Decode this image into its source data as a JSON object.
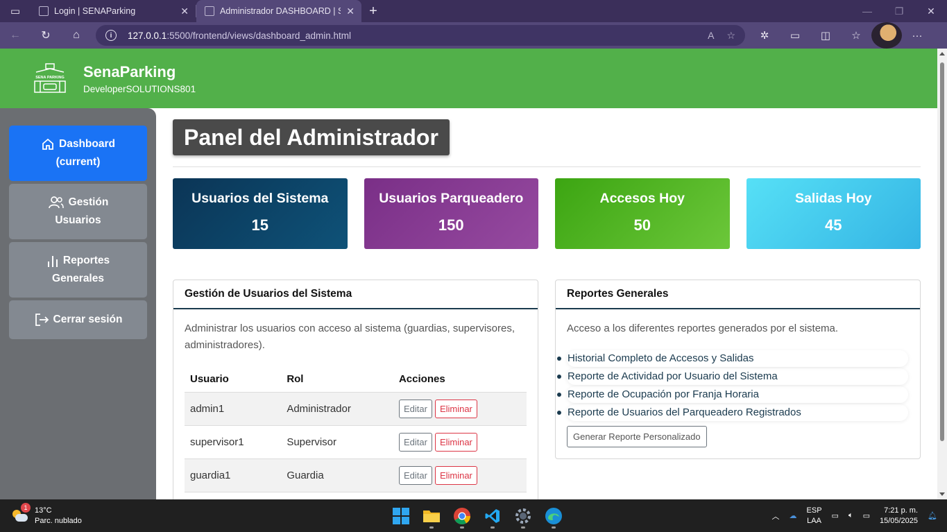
{
  "browser": {
    "tabs": [
      {
        "title": "Login | SENAParking",
        "active": false
      },
      {
        "title": "Administrador DASHBOARD | SEN",
        "active": true
      }
    ],
    "url_host": "127.0.0.1",
    "url_path": ":5500/frontend/views/dashboard_admin.html"
  },
  "header": {
    "brand": "SenaParking",
    "subtitle": "DeveloperSOLUTIONS801",
    "logo_text": "SENA PARKING"
  },
  "sidebar": {
    "items": [
      {
        "label_line1": "Dashboard",
        "label_line2": "(current)",
        "active": true
      },
      {
        "label_line1": "Gestión",
        "label_line2": "Usuarios",
        "active": false
      },
      {
        "label_line1": "Reportes",
        "label_line2": "Generales",
        "active": false
      },
      {
        "label_line1": "Cerrar sesión",
        "label_line2": "",
        "active": false
      }
    ]
  },
  "main": {
    "title": "Panel del Administrador",
    "cards": [
      {
        "label": "Usuarios del Sistema",
        "value": "15"
      },
      {
        "label": "Usuarios Parqueadero",
        "value": "150"
      },
      {
        "label": "Accesos Hoy",
        "value": "50"
      },
      {
        "label": "Salidas Hoy",
        "value": "45"
      }
    ],
    "users_panel": {
      "heading": "Gestión de Usuarios del Sistema",
      "description": "Administrar los usuarios con acceso al sistema (guardias, supervisores, administradores).",
      "columns": [
        "Usuario",
        "Rol",
        "Acciones"
      ],
      "rows": [
        {
          "user": "admin1",
          "role": "Administrador"
        },
        {
          "user": "supervisor1",
          "role": "Supervisor"
        },
        {
          "user": "guardia1",
          "role": "Guardia"
        }
      ],
      "edit_label": "Editar",
      "delete_label": "Eliminar"
    },
    "reports_panel": {
      "heading": "Reportes Generales",
      "description": "Acceso a los diferentes reportes generados por el sistema.",
      "links": [
        "Historial Completo de Accesos y Salidas",
        "Reporte de Actividad por Usuario del Sistema",
        "Reporte de Ocupación por Franja Horaria",
        "Reporte de Usuarios del Parqueadero Registrados"
      ],
      "button": "Generar Reporte Personalizado"
    }
  },
  "taskbar": {
    "weather_temp": "13°C",
    "weather_desc": "Parc. nublado",
    "weather_badge": "1",
    "lang_line1": "ESP",
    "lang_line2": "LAA",
    "time": "7:21 p. m.",
    "date": "15/05/2025"
  },
  "colors": {
    "header_green": "#52b04a",
    "sidebar_active": "#1a73f5",
    "card_1": "#0b3556",
    "card_2": "#7a2f87",
    "card_3": "#3ca512",
    "card_4": "#56e0f6"
  }
}
